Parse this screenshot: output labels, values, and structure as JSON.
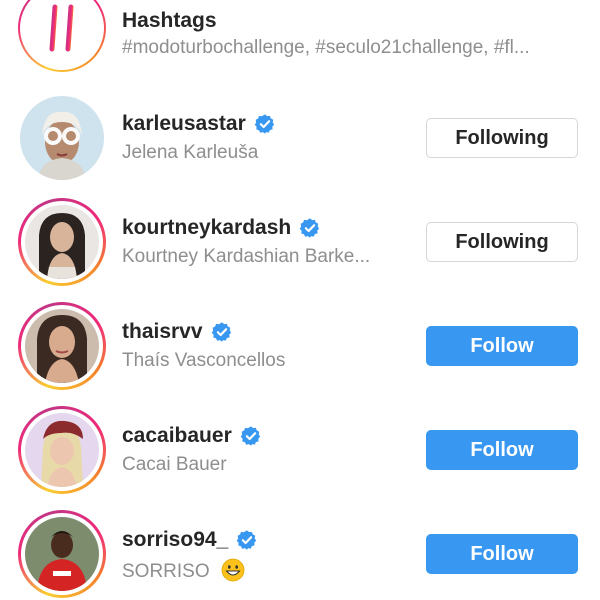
{
  "hashtags": {
    "title": "Hashtags",
    "subtitle": "#modoturbochallenge, #seculo21challenge, #fl..."
  },
  "accounts": [
    {
      "username": "karleusastar",
      "full_name": "Jelena Karleuša",
      "verified": true,
      "button_label": "Following",
      "button_state": "following",
      "has_story_ring": false
    },
    {
      "username": "kourtneykardash",
      "full_name": "Kourtney Kardashian Barke...",
      "verified": true,
      "button_label": "Following",
      "button_state": "following",
      "has_story_ring": true
    },
    {
      "username": "thaisrvv",
      "full_name": "Thaís Vasconcellos",
      "verified": true,
      "button_label": "Follow",
      "button_state": "follow",
      "has_story_ring": true
    },
    {
      "username": "cacaibauer",
      "full_name": "Cacai Bauer",
      "verified": true,
      "button_label": "Follow",
      "button_state": "follow",
      "has_story_ring": true
    },
    {
      "username": "sorriso94_",
      "full_name": "SORRISO",
      "full_name_emoji": "grinning-face-emoji",
      "verified": true,
      "button_label": "Follow",
      "button_state": "follow",
      "has_story_ring": true
    }
  ],
  "colors": {
    "follow_button": "#3897f0",
    "verified_badge": "#3897f0",
    "secondary_text": "#8e8e8e"
  }
}
